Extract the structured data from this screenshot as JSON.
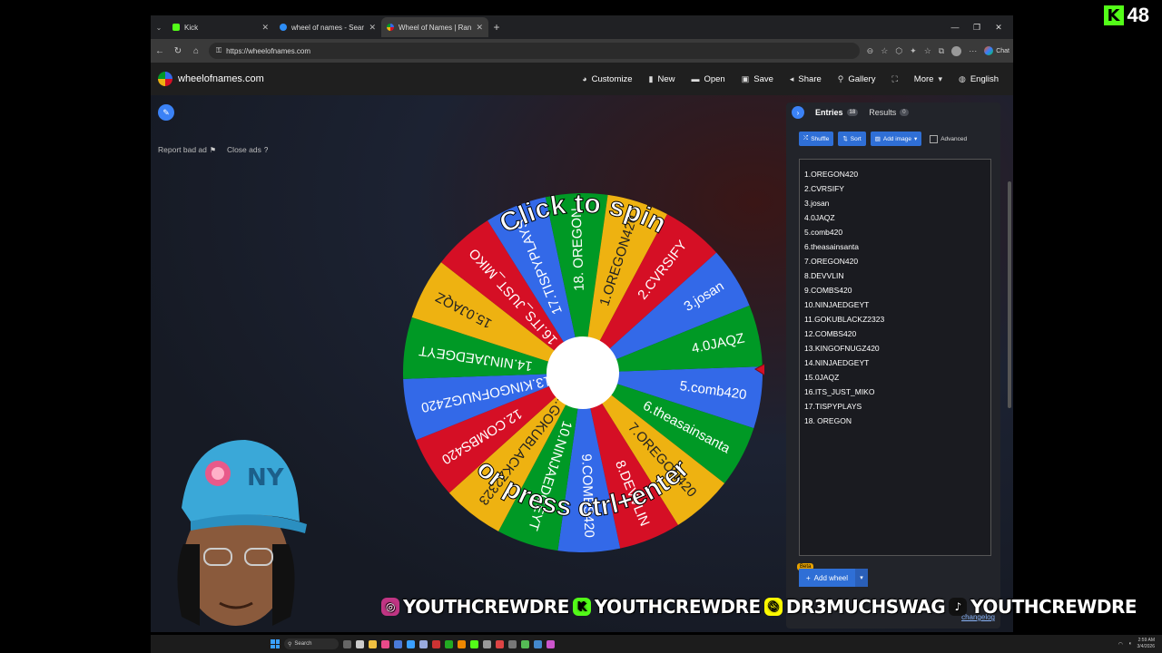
{
  "stream": {
    "viewer_count": "48"
  },
  "browser": {
    "tabs": [
      {
        "title": "Kick",
        "color": "#53fc18",
        "active": false
      },
      {
        "title": "wheel of names - Search",
        "color": "#2e8ef7",
        "active": false
      },
      {
        "title": "Wheel of Names | Random name",
        "color": "#3369e8",
        "active": true
      }
    ],
    "url": "https://wheelofnames.com",
    "chat_label": "Chat"
  },
  "site": {
    "logo_text": "wheelofnames.com",
    "menu": [
      {
        "label": "Customize",
        "icon": "palette-icon"
      },
      {
        "label": "New",
        "icon": "file-icon"
      },
      {
        "label": "Open",
        "icon": "folder-icon"
      },
      {
        "label": "Save",
        "icon": "save-icon"
      },
      {
        "label": "Share",
        "icon": "share-icon"
      },
      {
        "label": "Gallery",
        "icon": "search-icon"
      },
      {
        "label": "",
        "icon": "fullscreen-icon"
      },
      {
        "label": "More",
        "icon": "chevron-down-icon"
      },
      {
        "label": "English",
        "icon": "globe-icon"
      }
    ]
  },
  "page": {
    "report_ad": "Report bad ad",
    "close_ads": "Close ads"
  },
  "wheel": {
    "top_text": "Click to spin",
    "bottom_text": "or press ctrl+enter",
    "colors": [
      "#3369e8",
      "#009925",
      "#eeb211",
      "#d50f25"
    ],
    "slices": [
      "5.comb420",
      "6.theasainsanta",
      "7.OREGON420",
      "8.DEVVLIN",
      "9.COMBS420",
      "10.NINJAEDGEYT",
      "11.GOKUBLACKZ2323",
      "12.COMBS420",
      "13.KINGOFNUGZ420",
      "14.NINJAEDGEYT",
      "15.0JAQZ",
      "16.ITS_JUST_MIKO",
      "17.TISPYPLAYS",
      "18. OREGON",
      "1.OREGON420",
      "2.CVRSIFY",
      "3.josan",
      "4.0JAQZ"
    ]
  },
  "panel": {
    "entries_label": "Entries",
    "entries_count": "18",
    "results_label": "Results",
    "results_count": "0",
    "shuffle": "Shuffle",
    "sort": "Sort",
    "add_image": "Add image",
    "advanced": "Advanced",
    "entries": [
      "1.OREGON420",
      "2.CVRSIFY",
      "3.josan",
      "4.0JAQZ",
      "5.comb420",
      "6.theasainsanta",
      "7.OREGON420",
      "8.DEVVLIN",
      "9.COMBS420",
      "10.NINJAEDGEYT",
      "11.GOKUBLACKZ2323",
      "12.COMBS420",
      "13.KINGOFNUGZ420",
      "14.NINJAEDGEYT",
      "15.0JAQZ",
      "16.ITS_JUST_MIKO",
      "17.TISPYPLAYS",
      "18. OREGON"
    ],
    "beta": "Beta",
    "add_wheel": "Add wheel",
    "changelog": "changelog"
  },
  "socials": [
    {
      "platform": "instagram-icon",
      "handle": "YOUTHCREWDRE",
      "color": "#c13584"
    },
    {
      "platform": "kick-icon",
      "handle": "YOUTHCREWDRE",
      "color": "#53fc18"
    },
    {
      "platform": "snapchat-icon",
      "handle": "DR3MUCHSWAG",
      "color": "#fffc00"
    },
    {
      "platform": "tiktok-icon",
      "handle": "YOUTHCREWDRE",
      "color": "#111111"
    }
  ],
  "taskbar": {
    "search": "Search",
    "time": "2:59 AM",
    "date": "3/4/2026"
  }
}
